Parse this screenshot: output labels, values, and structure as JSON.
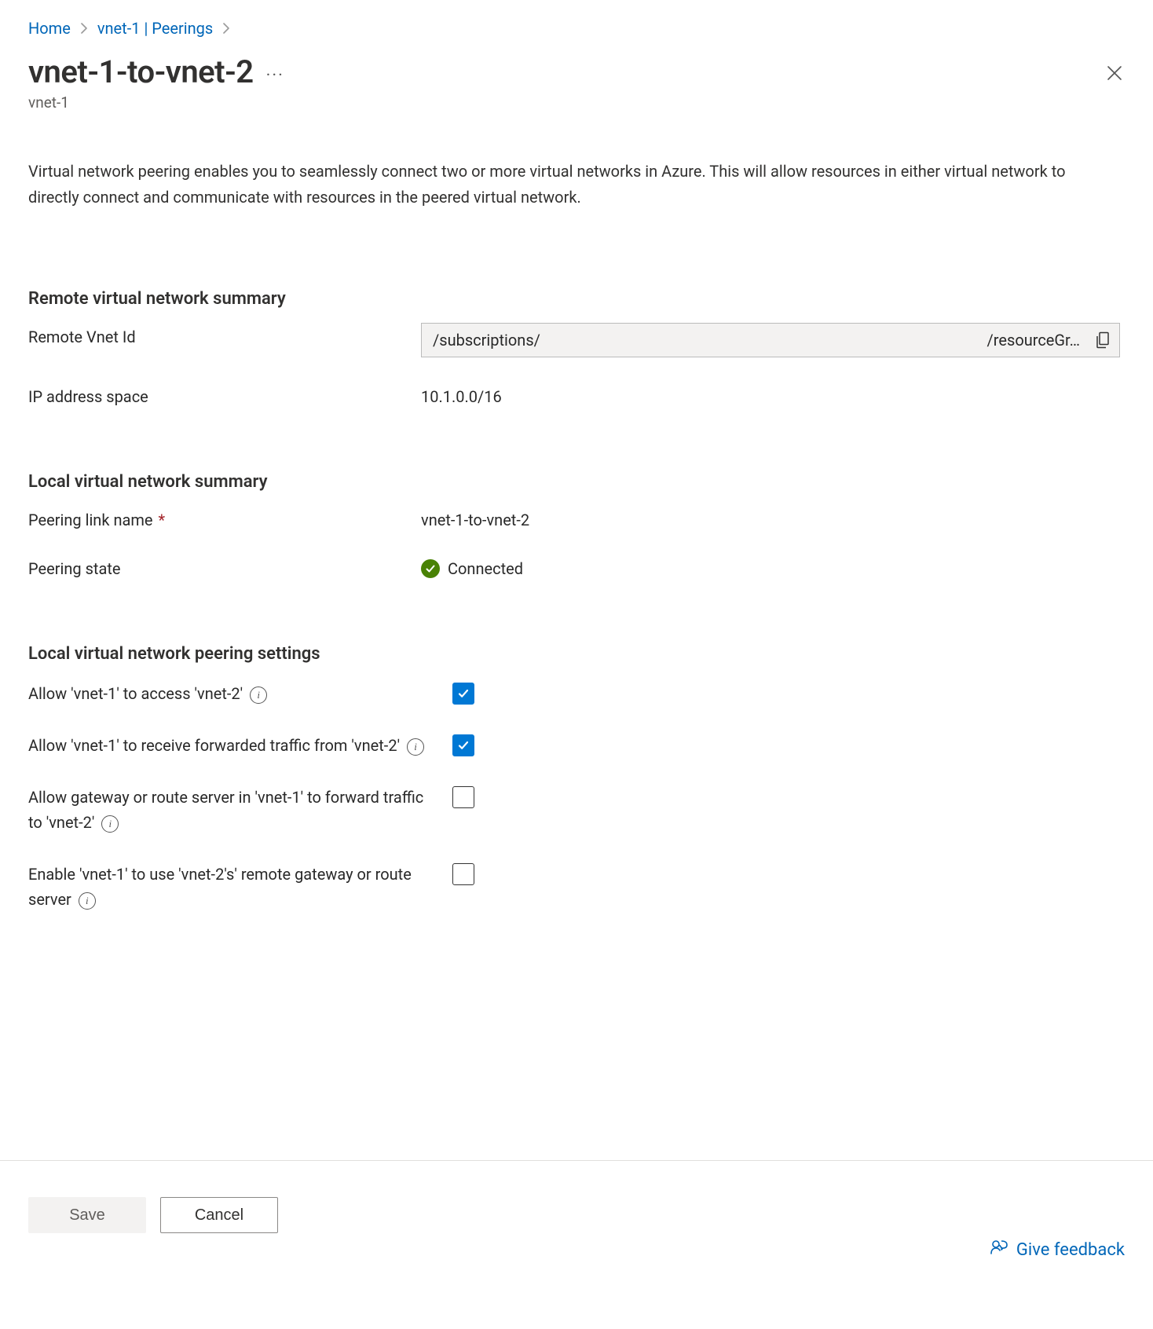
{
  "breadcrumb": {
    "home": "Home",
    "peerings": "vnet-1 | Peerings"
  },
  "title": {
    "heading": "vnet-1-to-vnet-2",
    "subtitle": "vnet-1"
  },
  "description": "Virtual network peering enables you to seamlessly connect two or more virtual networks in Azure. This will allow resources in either virtual network to directly connect and communicate with resources in the peered virtual network.",
  "remote": {
    "heading": "Remote virtual network summary",
    "vnetIdLabel": "Remote Vnet Id",
    "vnetIdStart": "/subscriptions/",
    "vnetIdEnd": "/resourceGr…",
    "ipSpaceLabel": "IP address space",
    "ipSpaceValue": "10.1.0.0/16"
  },
  "local": {
    "heading": "Local virtual network summary",
    "linkNameLabel": "Peering link name",
    "linkNameValue": "vnet-1-to-vnet-2",
    "stateLabel": "Peering state",
    "stateValue": "Connected"
  },
  "settings": {
    "heading": "Local virtual network peering settings",
    "items": [
      {
        "label": "Allow 'vnet-1' to access 'vnet-2'",
        "checked": true
      },
      {
        "label": "Allow 'vnet-1' to receive forwarded traffic from 'vnet-2'",
        "checked": true
      },
      {
        "label": "Allow gateway or route server in 'vnet-1' to forward traffic to 'vnet-2'",
        "checked": false
      },
      {
        "label": "Enable 'vnet-1' to use 'vnet-2's' remote gateway or route server",
        "checked": false
      }
    ]
  },
  "footer": {
    "save": "Save",
    "cancel": "Cancel",
    "feedback": "Give feedback"
  }
}
